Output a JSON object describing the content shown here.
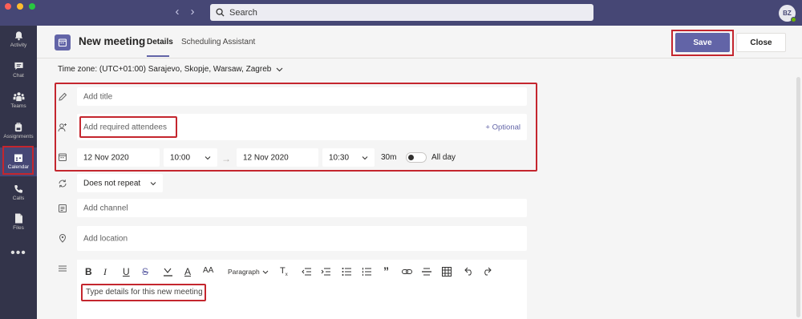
{
  "search": {
    "placeholder": "Search"
  },
  "user": {
    "initials": "BZ"
  },
  "rail": [
    {
      "label": "Activity"
    },
    {
      "label": "Chat"
    },
    {
      "label": "Teams"
    },
    {
      "label": "Assignments"
    },
    {
      "label": "Calendar"
    },
    {
      "label": "Calls"
    },
    {
      "label": "Files"
    }
  ],
  "rail_more": "•••",
  "header": {
    "title": "New meeting",
    "tab_details": "Details",
    "tab_scheduling": "Scheduling Assistant",
    "save_label": "Save",
    "close_label": "Close"
  },
  "timezone": "Time zone: (UTC+01:00) Sarajevo, Skopje, Warsaw, Zagreb",
  "form": {
    "title_placeholder": "Add title",
    "attendees_placeholder": "Add required attendees",
    "optional_label": "+ Optional",
    "start_date": "12 Nov 2020",
    "start_time": "10:00",
    "end_date": "12 Nov 2020",
    "end_time": "10:30",
    "duration": "30m",
    "all_day_label": "All day",
    "all_day_on": false,
    "repeat": "Does not repeat",
    "channel_placeholder": "Add channel",
    "location_placeholder": "Add location",
    "paragraph_label": "Paragraph",
    "details_placeholder": "Type details for this new meeting"
  },
  "colors": {
    "brand": "#6264a7",
    "titlebar": "#464775",
    "rail": "#33344a",
    "highlight": "#c4262e"
  }
}
